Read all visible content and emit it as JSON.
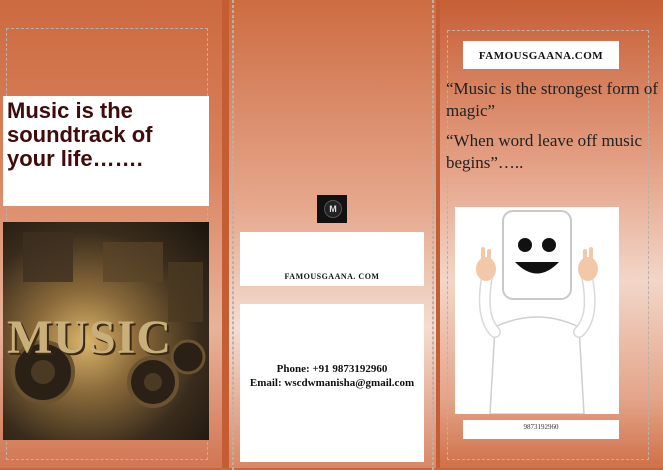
{
  "left_panel": {
    "headline": "Music is the soundtrack of your life…….",
    "photo_text": "MUSIC"
  },
  "middle_panel": {
    "logo_letter": "M",
    "site_name": "FAMOUSGAANA. COM",
    "phone": "Phone: +91  9873192960",
    "email": "Email: wscdwmanisha@gmail.com"
  },
  "right_panel": {
    "header": "FAMOUSGAANA.COM",
    "quote1": "“Music is the strongest form of magic”",
    "quote2": "“When word leave off music begins”…..",
    "caption": "9873192960"
  },
  "colors": {
    "background": "#c9663e",
    "headline": "#3f0b0b"
  }
}
